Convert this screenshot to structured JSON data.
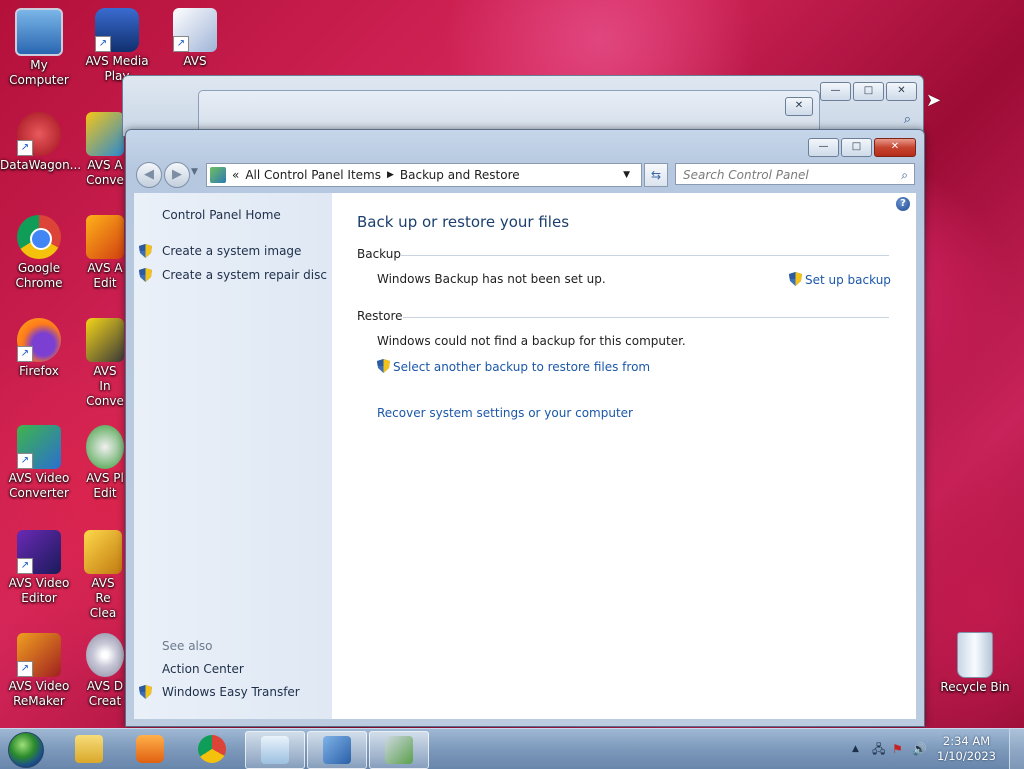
{
  "desktop": {
    "icons_left": [
      {
        "label": "My Computer",
        "icon": "computer-icon"
      },
      {
        "label": "DataWagon...",
        "icon": "datawagon-icon"
      },
      {
        "label": "Google Chrome",
        "icon": "chrome-icon"
      },
      {
        "label": "Firefox",
        "icon": "firefox-icon"
      },
      {
        "label": "AVS Video Converter",
        "icon": "avs-video-converter-icon"
      },
      {
        "label": "AVS Video Editor",
        "icon": "avs-video-editor-icon"
      },
      {
        "label": "AVS Video ReMaker",
        "icon": "avs-video-remaker-icon"
      }
    ],
    "icons_second": [
      {
        "label": "AVS Media Play",
        "icon": "avs-media-player-icon"
      },
      {
        "label": "AVS A Conve",
        "icon": "avs-audio-converter-icon"
      },
      {
        "label": "AVS A Edit",
        "icon": "avs-audio-editor-icon"
      },
      {
        "label": "AVS In Conve",
        "icon": "avs-image-converter-icon"
      },
      {
        "label": "AVS Pl Edit",
        "icon": "avs-photo-editor-icon"
      },
      {
        "label": "AVS Re Clea",
        "icon": "avs-registry-cleaner-icon"
      },
      {
        "label": "AVS D Creat",
        "icon": "avs-disc-creator-icon"
      }
    ],
    "icon_top": {
      "label": "AVS",
      "icon": "avs-icon"
    },
    "recycle_bin": {
      "label": "Recycle Bin",
      "icon": "recycle-bin-icon"
    }
  },
  "window": {
    "breadcrumb": {
      "prefix": "«",
      "item1": "All Control Panel Items",
      "separator": "▶",
      "item2": "Backup and Restore"
    },
    "search_placeholder": "Search Control Panel",
    "left_pane": {
      "home": "Control Panel Home",
      "tasks": [
        "Create a system image",
        "Create a system repair disc"
      ],
      "see_also_label": "See also",
      "see_also": [
        "Action Center",
        "Windows Easy Transfer"
      ]
    },
    "main": {
      "title": "Back up or restore your files",
      "backup_header": "Backup",
      "backup_status": "Windows Backup has not been set up.",
      "setup_link": "Set up backup",
      "restore_header": "Restore",
      "restore_status": "Windows could not find a backup for this computer.",
      "select_link": "Select another backup to restore files from",
      "recover_link": "Recover system settings or your computer"
    }
  },
  "taskbar": {
    "time": "2:34 AM",
    "date": "1/10/2023",
    "items": [
      "file-explorer-icon",
      "media-player-icon",
      "chrome-icon",
      "notepad-icon",
      "control-panel-icon",
      "backup-icon"
    ]
  },
  "colors": {
    "link": "#1b57a8",
    "title": "#1c3f6e",
    "left_pane": "#e4ecf6"
  }
}
